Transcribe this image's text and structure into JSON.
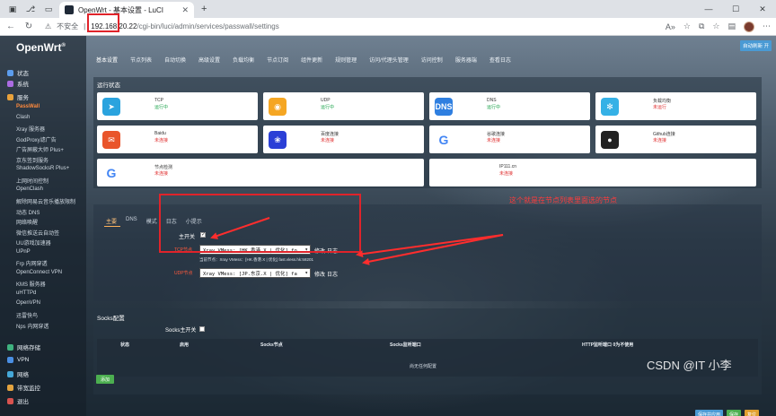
{
  "browser": {
    "tab_title": "OpenWrt - 基本设置 - LuCI",
    "insecure_label": "不安全",
    "url_host": "192.168.20.22",
    "url_path": "/cgi-bin/luci/admin/services/passwall/settings"
  },
  "logo": "OpenWrt",
  "logout_label": "自动刷新 开",
  "sidebar": {
    "top_items": [
      {
        "label": "状态",
        "color": "#5c9ded"
      },
      {
        "label": "系统",
        "color": "#ab6ce2"
      },
      {
        "label": "服务",
        "color": "#e9a23b"
      }
    ],
    "service_items": [
      "PassWall",
      "Clash",
      "Xray 服务器",
      "GodProxy滤广告",
      "广告屏蔽大师 Plus+",
      "京东签到服务",
      "ShadowSocksR Plus+",
      "上网时间控制",
      "OpenClash",
      "解除网易云音乐播放限制",
      "动态 DNS",
      "网络唤醒",
      "微信推送云自动签",
      "UU游戏加速器",
      "UPnP",
      "Frp 内网穿透",
      "OpenConnect VPN",
      "KMS 服务器",
      "uHTTPd",
      "OpenVPN",
      "迅雷快鸟",
      "Nps 内网穿透"
    ],
    "bottom_items": [
      {
        "label": "网络存储",
        "color": "#3fb27f"
      },
      {
        "label": "VPN",
        "color": "#4a8fe3"
      },
      {
        "label": "网络",
        "color": "#45a8d8"
      },
      {
        "label": "带宽监控",
        "color": "#e3a33f"
      },
      {
        "label": "退出",
        "color": "#d8534f"
      }
    ]
  },
  "topnav": [
    "基本设置",
    "节点列表",
    "自动切换",
    "高级设置",
    "负载均衡",
    "节点订阅",
    "组件更新",
    "规则管理",
    "访问/代理头管理",
    "访问控制",
    "服务器端",
    "查看日志"
  ],
  "status": {
    "title": "运行状态",
    "cards": [
      {
        "name": "TCP",
        "status": "运行中",
        "ok": true,
        "icon": "telegram-icon",
        "color": "#2aa3de",
        "glyph": "➤"
      },
      {
        "name": "UDP",
        "status": "运行中",
        "ok": true,
        "icon": "gamepad-icon",
        "color": "#f5a623",
        "glyph": "◉"
      },
      {
        "name": "DNS",
        "status": "运行中",
        "ok": true,
        "icon": "dns-icon",
        "color": "#2f7fe0",
        "glyph": "DNS"
      },
      {
        "name": "负载均衡",
        "status": "未运行",
        "ok": false,
        "icon": "snowflake-icon",
        "color": "#35b1e6",
        "glyph": "✻"
      },
      {
        "name": "Baidu",
        "status": "未连接",
        "ok": false,
        "icon": "baidu-icon",
        "color": "#e9552b",
        "glyph": "✉"
      },
      {
        "name": "百度连接",
        "status": "未连接",
        "ok": false,
        "icon": "paw-icon",
        "color": "#2b3fd6",
        "glyph": "❀"
      },
      {
        "name": "谷歌连接",
        "status": "未连接",
        "ok": false,
        "icon": "google-icon",
        "color": "#ffffff",
        "glyph": "G"
      },
      {
        "name": "Github连接",
        "status": "未连接",
        "ok": false,
        "icon": "github-icon",
        "color": "#222222",
        "glyph": "●"
      },
      {
        "name": "节点检测",
        "status": "未连接",
        "ok": false,
        "icon": "google-icon",
        "color": "#ffffff",
        "glyph": "G"
      },
      {
        "name": "IP111.cn",
        "status": "未连接",
        "ok": false,
        "icon": "none",
        "color": "#ffffff",
        "glyph": ""
      }
    ]
  },
  "main": {
    "tabs": [
      "主要",
      "DNS",
      "模式",
      "日志",
      "小提示"
    ],
    "switch_label": "主开关",
    "tcp_label": "TCP节点",
    "tcp_value": "Xray VMess: [HK.香港.X | 优化] fo",
    "current_node": "当前节点：Xray VMess：[HK.香港.X | 优化] fast.vless.hk:58201",
    "udp_label": "UDP节点",
    "udp_value": "Xray VMess: [JP.东京.X | 优化] fa",
    "edit_label": "修改",
    "log_label": "日志",
    "annotation": "这个就是在节点列表里面选的节点"
  },
  "socks": {
    "title": "Socks配置",
    "switch_label": "Socks主开关",
    "headers": [
      "状态",
      "启用",
      "Socks节点",
      "Socks监听端口",
      "HTTP监听端口 0为不使用"
    ],
    "empty_text": "尚无任何配置",
    "add_label": "添加"
  },
  "footer_buttons": [
    {
      "label": "保存并应用",
      "color": "#4a9ad4"
    },
    {
      "label": "保存",
      "color": "#4caf50"
    },
    {
      "label": "复位",
      "color": "#e0a030"
    }
  ],
  "watermark": "CSDN @IT 小李"
}
